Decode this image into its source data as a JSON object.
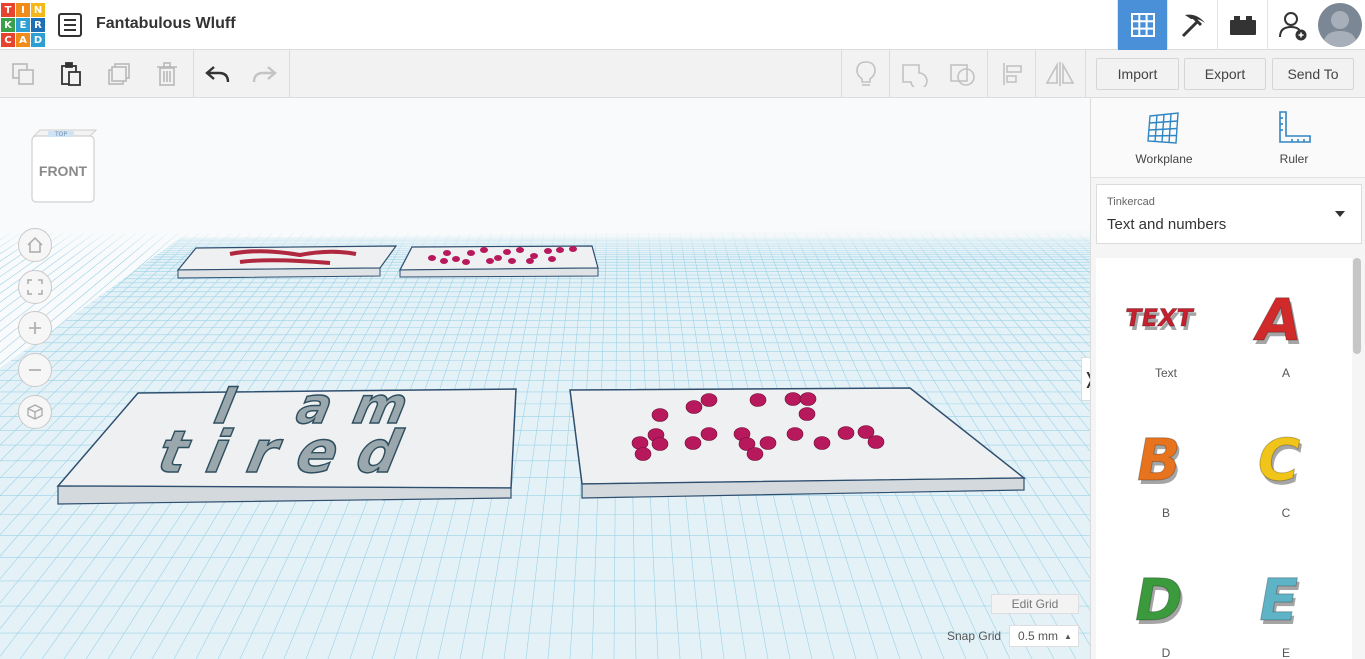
{
  "header": {
    "logo_letters": [
      "T",
      "I",
      "N",
      "K",
      "E",
      "R",
      "C",
      "A",
      "D"
    ],
    "logo_colors": [
      "#e8432e",
      "#f08c1c",
      "#f5b81a",
      "#3aa04a",
      "#2e9fd3",
      "#1d6fb6",
      "#e8432e",
      "#f08c1c",
      "#2e9fd3"
    ],
    "title": "Fantabulous Wluff",
    "view_buttons": [
      "grid-view-icon",
      "pickaxe-icon",
      "brick-icon",
      "add-user-icon"
    ]
  },
  "toolbar": {
    "left_icons": [
      "copy-icon",
      "paste-icon",
      "duplicate-icon",
      "delete-icon",
      "undo-icon",
      "redo-icon"
    ],
    "right_icons": [
      "lightbulb-icon",
      "group-icon",
      "ungroup-icon",
      "align-icon",
      "mirror-icon"
    ],
    "import_label": "Import",
    "export_label": "Export",
    "send_to_label": "Send To"
  },
  "viewport": {
    "viewcube_top": "TOP",
    "viewcube_front": "FRONT",
    "nav_icons": [
      "home-icon",
      "fit-view-icon",
      "zoom-in-icon",
      "zoom-out-icon",
      "perspective-icon"
    ],
    "plate_text_line1": "I am",
    "plate_text_line2": "tired",
    "edit_grid_label": "Edit Grid",
    "snap_grid_label": "Snap Grid",
    "snap_grid_value": "0.5 mm"
  },
  "panel": {
    "workplane_label": "Workplane",
    "ruler_label": "Ruler",
    "library_small": "Tinkercad",
    "library_value": "Text and numbers",
    "shapes": [
      {
        "label": "Text",
        "color": "#c8202f",
        "glyph": "TEXT"
      },
      {
        "label": "A",
        "color": "#d02a2a",
        "glyph": "A"
      },
      {
        "label": "B",
        "color": "#e8731f",
        "glyph": "B"
      },
      {
        "label": "C",
        "color": "#f0c419",
        "glyph": "C"
      },
      {
        "label": "D",
        "color": "#3a9a3c",
        "glyph": "D"
      },
      {
        "label": "E",
        "color": "#5fb3c6",
        "glyph": "E"
      }
    ]
  }
}
